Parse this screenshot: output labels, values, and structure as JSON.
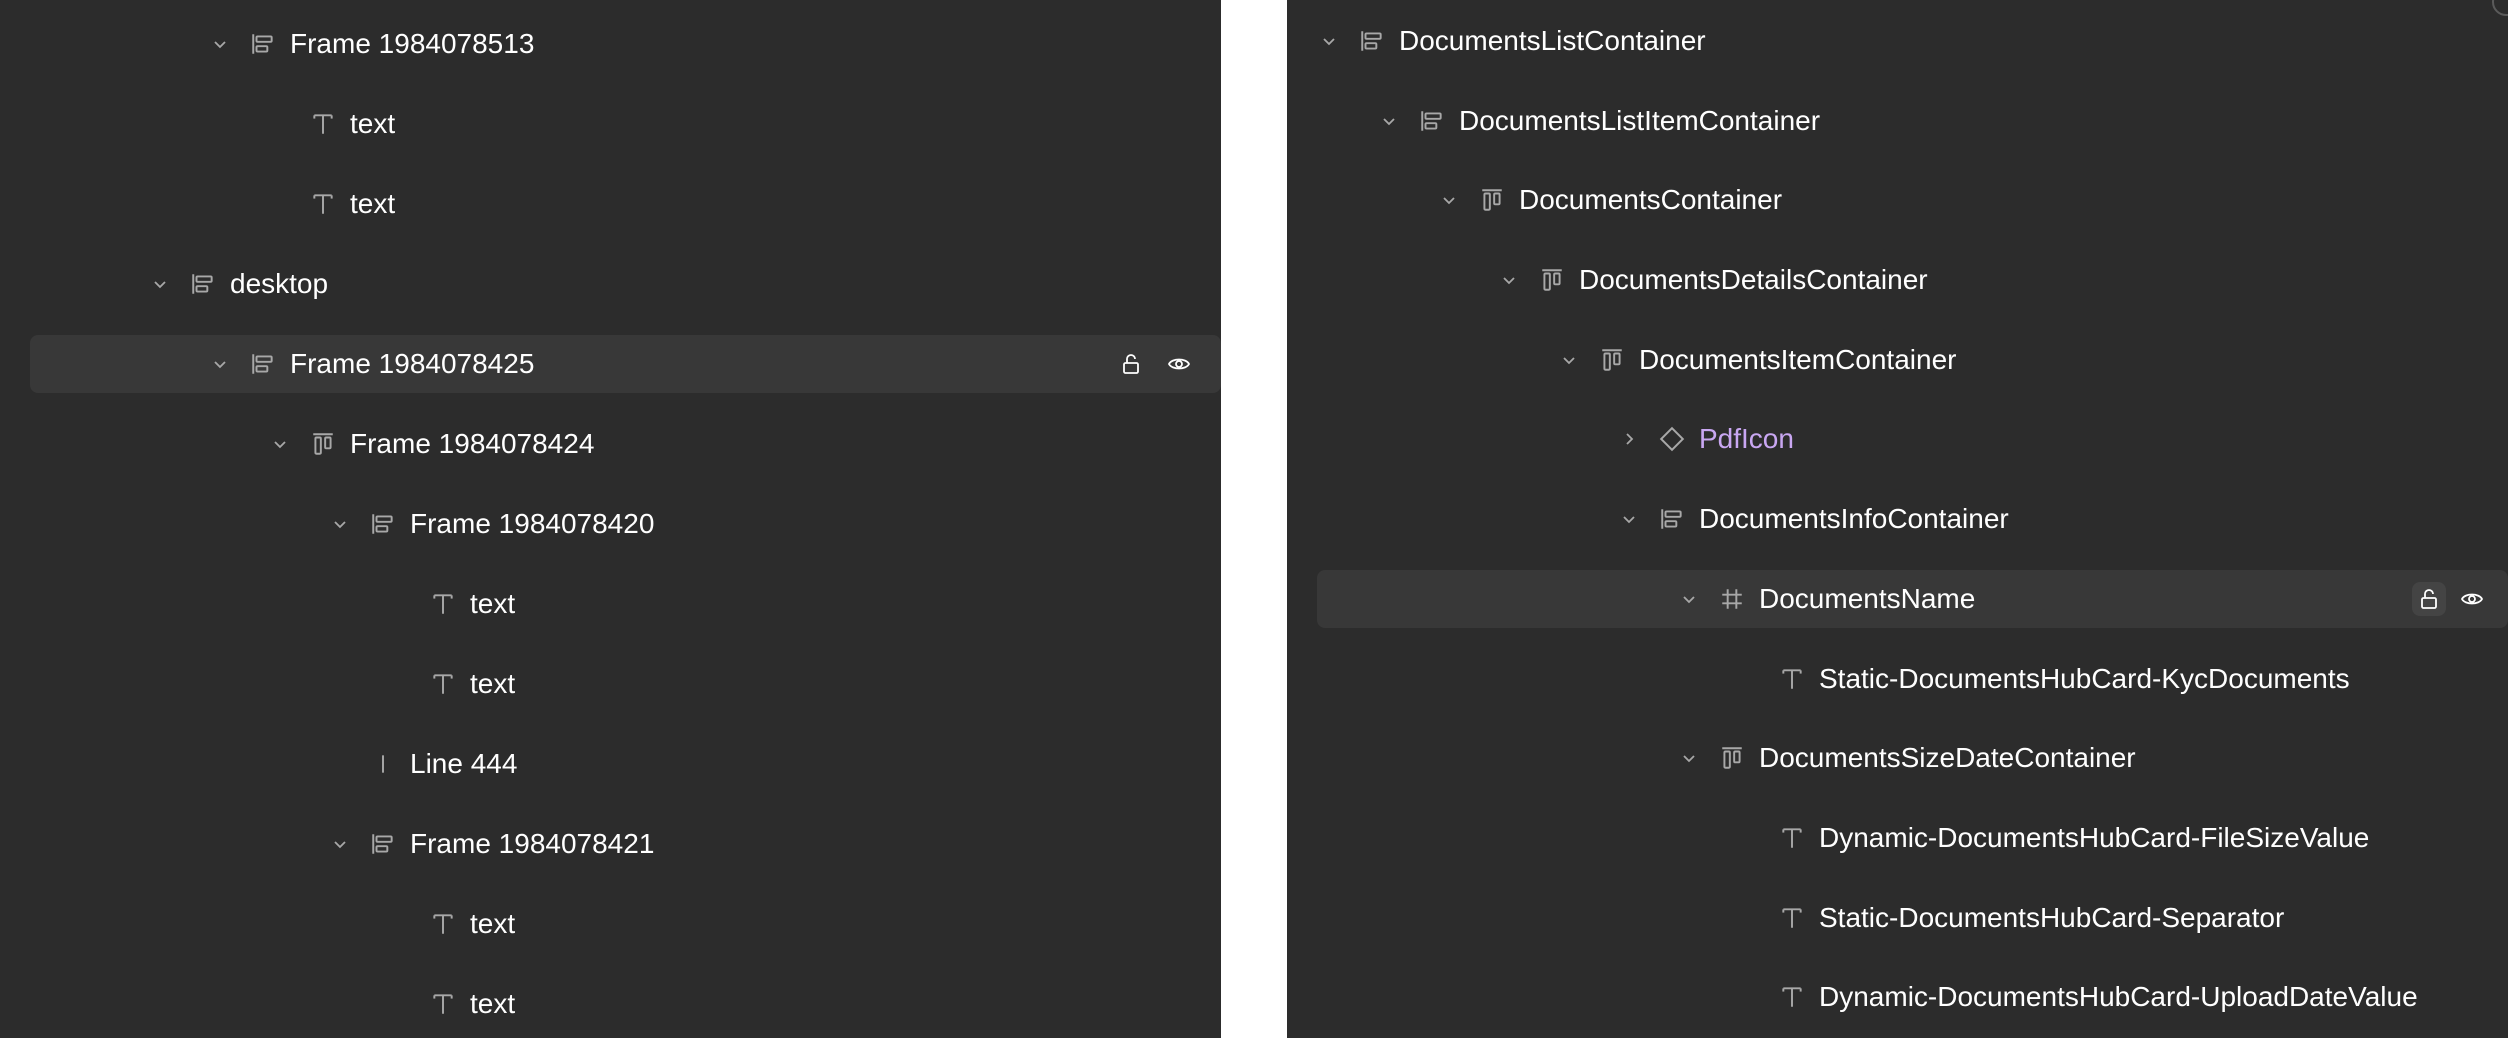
{
  "left_panel": {
    "rows": [
      {
        "label": "Frame 1984078513",
        "icon": "stack-layout-icon",
        "expanded": true
      },
      {
        "label": "text",
        "icon": "text-icon"
      },
      {
        "label": "text",
        "icon": "text-icon"
      },
      {
        "label": "desktop",
        "icon": "stack-layout-icon",
        "expanded": true
      },
      {
        "label": "Frame 1984078425",
        "icon": "stack-layout-icon",
        "expanded": true,
        "selected": true,
        "actions": [
          "lock-icon",
          "eye-icon"
        ]
      },
      {
        "label": "Frame 1984078424",
        "icon": "columns-layout-icon",
        "expanded": true
      },
      {
        "label": "Frame 1984078420",
        "icon": "stack-layout-icon",
        "expanded": true
      },
      {
        "label": "text",
        "icon": "text-icon"
      },
      {
        "label": "text",
        "icon": "text-icon"
      },
      {
        "label": "Line 444",
        "icon": "line-icon"
      },
      {
        "label": "Frame 1984078421",
        "icon": "stack-layout-icon",
        "expanded": true
      },
      {
        "label": "text",
        "icon": "text-icon"
      },
      {
        "label": "text",
        "icon": "text-icon"
      }
    ]
  },
  "right_panel": {
    "rows": [
      {
        "label": "DocumentsListContainer",
        "icon": "stack-layout-icon",
        "expanded": true
      },
      {
        "label": "DocumentsListItemContainer",
        "icon": "stack-layout-icon",
        "expanded": true
      },
      {
        "label": "DocumentsContainer",
        "icon": "columns-layout-icon",
        "expanded": true
      },
      {
        "label": "DocumentsDetailsContainer",
        "icon": "columns-layout-icon",
        "expanded": true
      },
      {
        "label": "DocumentsItemContainer",
        "icon": "columns-layout-icon",
        "expanded": true
      },
      {
        "label": "PdfIcon",
        "icon": "component-instance-icon",
        "expanded": false,
        "component": true
      },
      {
        "label": "DocumentsInfoContainer",
        "icon": "stack-layout-icon",
        "expanded": true
      },
      {
        "label": "DocumentsName",
        "icon": "frame-hash-icon",
        "expanded": true,
        "selected": true,
        "actions": [
          "lock-icon",
          "eye-icon"
        ]
      },
      {
        "label": "Static-DocumentsHubCard-KycDocuments",
        "icon": "text-icon"
      },
      {
        "label": "DocumentsSizeDateContainer",
        "icon": "columns-layout-icon",
        "expanded": true
      },
      {
        "label": "Dynamic-DocumentsHubCard-FileSizeValue",
        "icon": "text-icon"
      },
      {
        "label": "Static-DocumentsHubCard-Separator",
        "icon": "text-icon"
      },
      {
        "label": "Dynamic-DocumentsHubCard-UploadDateValue",
        "icon": "text-icon"
      }
    ]
  },
  "colors": {
    "panel_bg": "#2c2c2c",
    "selected_row_bg": "#383838",
    "text": "#ffffff",
    "icon": "#a8a8a8",
    "component_text": "#c9a7f2"
  }
}
